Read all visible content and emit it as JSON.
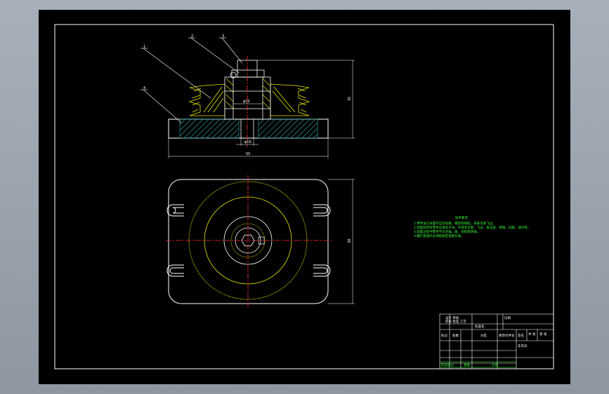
{
  "drawing": {
    "part_numbers": [
      "1",
      "2",
      "3",
      "4"
    ],
    "dimensions": {
      "height_total": "35",
      "inner_diameter": "φ10",
      "bore_diameter": "φ16",
      "base_width": "50",
      "plan_height": "38"
    },
    "technical_requirements": {
      "title": "技术要求",
      "lines": [
        "1.零件加工表面不应有划痕、擦伤等缺陷，去除毛刺飞边。",
        "2.装配前所有零件应清洗干净，不得有毛刺、飞边、氧化皮、锈蚀、切屑、油污等。",
        "3.装配过程中零件不允许磕、碰、划伤和锈蚀。",
        "4.螺钉紧固时必须按规定扭矩拧紧。"
      ]
    },
    "title_block": {
      "rows": [
        "设计 审核",
        "校核 批准 工艺",
        "标准化"
      ],
      "cells": [
        "比例",
        "共 张",
        "第 张"
      ],
      "labels": [
        "标记",
        "处数",
        "分区",
        "更改文件号",
        "签名",
        "年月日"
      ],
      "footer": [
        "阶段标记",
        "重量",
        "比例"
      ]
    }
  },
  "colors": {
    "background": "#000000",
    "frame": "#ffffff",
    "dimension": "#ffffff",
    "centerline": "#ff3030",
    "hatch": "#2aa7a7",
    "yellow": "#e6e600",
    "green": "#36ff36"
  }
}
